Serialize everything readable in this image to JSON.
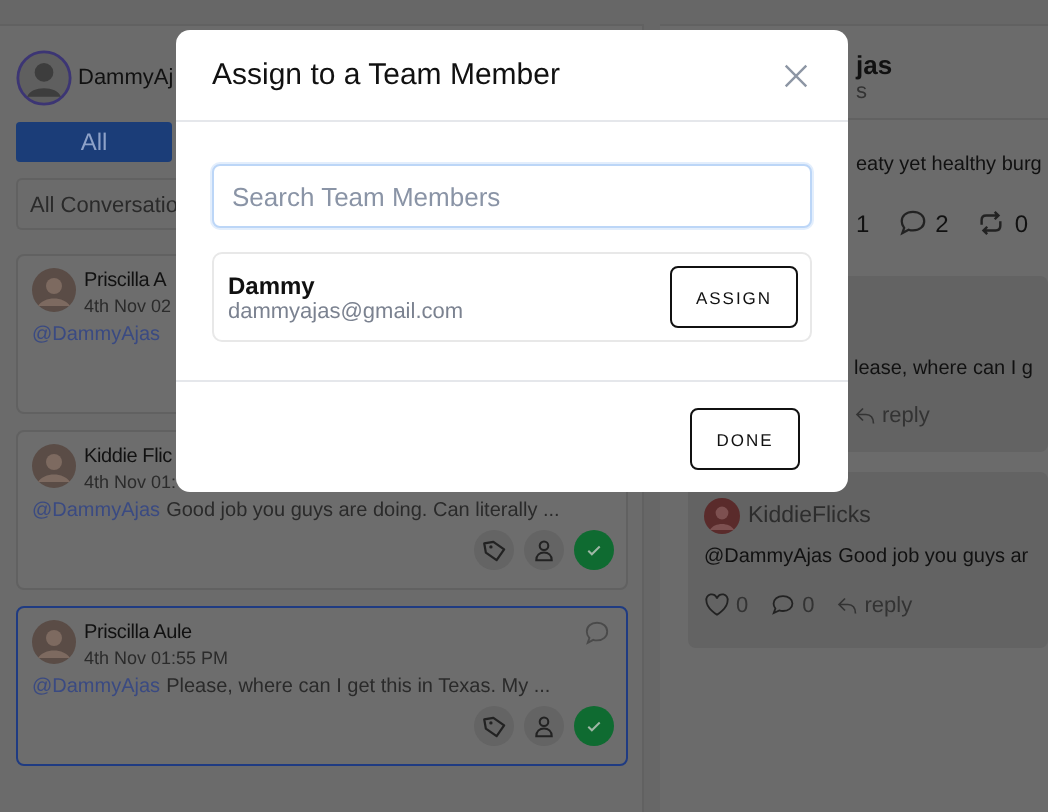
{
  "profile": {
    "name": "DammyAj"
  },
  "tabs": [
    {
      "label": "All",
      "selected": true
    }
  ],
  "filter": {
    "value": "All Conversatio"
  },
  "conversations": [
    {
      "name": "Priscilla A",
      "time": "4th Nov 02",
      "mention": "@DammyAjas",
      "selected": false
    },
    {
      "name": "Kiddie Flic",
      "time": "4th Nov 01:",
      "mention": "@DammyAjas",
      "text": "Good job you guys are doing. Can literally ...",
      "selected": false,
      "comment_icon": false,
      "actions": true
    },
    {
      "name": "Priscilla Aule",
      "time": "4th Nov 01:55 PM",
      "mention": "@DammyAjas",
      "text": "Please, where can I get this in Texas. My ...",
      "selected": true,
      "comment_icon": true,
      "actions": true
    }
  ],
  "post": {
    "author": "jas",
    "subtitle": "s",
    "text": "eaty yet healthy burg",
    "likes": "1",
    "comments": "2",
    "shares": "0"
  },
  "replies": [
    {
      "text": "lease, where can I g",
      "reply": "reply"
    },
    {
      "author": "KiddieFlicks",
      "mention": "@DammyAjas",
      "text": "Good job you guys ar",
      "likes": "0",
      "comments": "0",
      "reply": "reply"
    }
  ],
  "modal": {
    "title": "Assign to a Team Member",
    "search": {
      "placeholder": "Search Team Members"
    },
    "members": [
      {
        "name": "Dammy",
        "email": "dammyajas@gmail.com",
        "button": "ASSIGN"
      }
    ],
    "done": "DONE"
  }
}
